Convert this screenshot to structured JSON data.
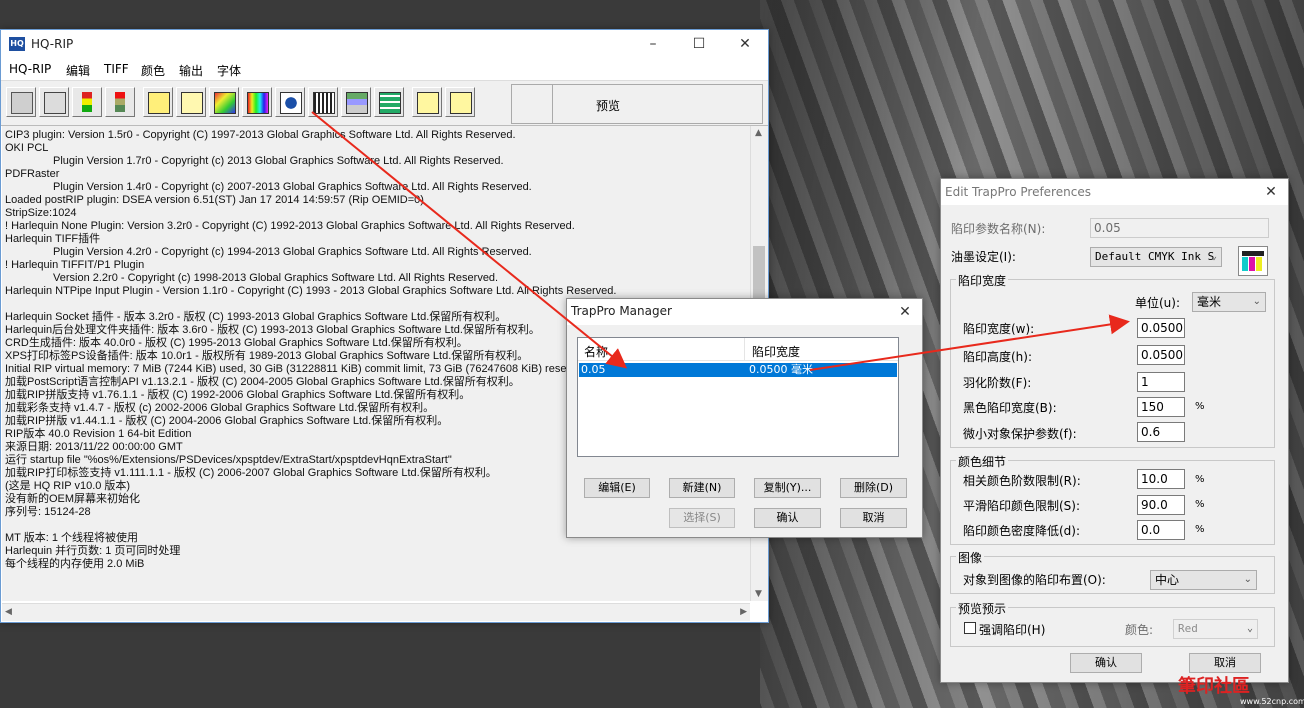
{
  "main": {
    "title": "HQ-RIP",
    "app_icon": "HQ",
    "menu": [
      "HQ-RIP",
      "编辑",
      "TIFF",
      "颜色",
      "输出",
      "字体"
    ],
    "toolbar_icons": [
      "printer-settings-icon",
      "print-queue-icon",
      "traffic-light-green-icon",
      "traffic-light-red-icon",
      "page-setup-icon",
      "document-list-icon",
      "color-palette-icon",
      "color-bars-icon",
      "calibration-icon",
      "film-icon",
      "stack-icon",
      "grid-layout-icon",
      "output-export-icon",
      "preview-image-icon"
    ],
    "preview_label": "预览",
    "log_lines": [
      {
        "t": "CIP3 plugin: Version 1.5r0 - Copyright (C) 1997-2013 Global Graphics Software Ltd. All Rights Reserved.",
        "i": false
      },
      {
        "t": "OKI PCL",
        "i": false
      },
      {
        "t": "Plugin Version 1.7r0 - Copyright (c) 2013 Global Graphics Software Ltd. All Rights Reserved.",
        "i": true
      },
      {
        "t": "PDFRaster",
        "i": false
      },
      {
        "t": "Plugin Version 1.4r0 - Copyright (c) 2007-2013 Global Graphics Software Ltd. All Rights Reserved.",
        "i": true
      },
      {
        "t": "Loaded postRIP plugin: DSEA version 6.51(ST) Jan 17 2014 14:59:57 (Rip OEMID=0)",
        "i": false
      },
      {
        "t": "StripSize:1024",
        "i": false
      },
      {
        "t": "! Harlequin None Plugin: Version 3.2r0 - Copyright (C) 1992-2013 Global Graphics Software Ltd. All Rights Reserved.",
        "i": false
      },
      {
        "t": "Harlequin TIFF插件",
        "i": false
      },
      {
        "t": "Plugin Version 4.2r0 - Copyright (c) 1994-2013 Global Graphics Software Ltd. All Rights Reserved.",
        "i": true
      },
      {
        "t": "! Harlequin TIFFIT/P1 Plugin",
        "i": false
      },
      {
        "t": "Version 2.2r0 - Copyright (c) 1998-2013 Global Graphics Software Ltd. All Rights Reserved.",
        "i": true
      },
      {
        "t": "Harlequin NTPipe Input Plugin - Version 1.1r0 - Copyright (C) 1993 - 2013 Global Graphics Software Ltd. All Rights Reserved.",
        "i": false
      },
      {
        "t": "",
        "i": false
      },
      {
        "t": "Harlequin Socket 插件 - 版本 3.2r0 - 版权 (C) 1993-2013 Global Graphics Software Ltd.保留所有权利。",
        "i": false
      },
      {
        "t": "Harlequin后台处理文件夹插件: 版本 3.6r0 - 版权 (C) 1993-2013 Global Graphics Software Ltd.保留所有权利。",
        "i": false
      },
      {
        "t": "CRD生成插件: 版本 40.0r0 - 版权 (C) 1995-2013 Global Graphics Software Ltd.保留所有权利。",
        "i": false
      },
      {
        "t": "XPS打印标签PS设备插件: 版本 10.0r1 - 版权所有 1989-2013 Global Graphics Software Ltd.保留所有权利。",
        "i": false
      },
      {
        "t": "Initial RIP virtual memory: 7 MiB (7244 KiB) used, 30 GiB (31228811 KiB) commit limit, 73 GiB (76247608 KiB) reserved",
        "i": false
      },
      {
        "t": "加载PostScript语言控制API v1.13.2.1 - 版权 (C) 2004-2005 Global Graphics Software Ltd.保留所有权利。",
        "i": false
      },
      {
        "t": "加载RIP拼版支持 v1.76.1.1 - 版权 (C) 1992-2006 Global Graphics Software Ltd.保留所有权利。",
        "i": false
      },
      {
        "t": "加载彩条支持 v1.4.7 - 版权 (c) 2002-2006 Global Graphics Software Ltd.保留所有权利。",
        "i": false
      },
      {
        "t": "加载RIP拼版 v1.44.1.1 - 版权 (C) 2004-2006 Global Graphics Software Ltd.保留所有权利。",
        "i": false
      },
      {
        "t": "RIP版本 40.0 Revision 1 64-bit Edition",
        "i": false
      },
      {
        "t": "来源日期: 2013/11/22 00:00:00 GMT",
        "i": false
      },
      {
        "t": "运行 startup file \"%os%/Extensions/PSDevices/xpsptdev/ExtraStart/xpsptdevHqnExtraStart\"",
        "i": false
      },
      {
        "t": "加载RIP打印标签支持 v1.111.1.1 - 版权 (C) 2006-2007 Global Graphics Software Ltd.保留所有权利。",
        "i": false
      },
      {
        "t": "(这是 HQ RIP v10.0 版本)",
        "i": false
      },
      {
        "t": "没有新的OEM屏幕来初始化",
        "i": false
      },
      {
        "t": "序列号: 15124-28",
        "i": false
      },
      {
        "t": "",
        "i": false
      },
      {
        "t": "MT 版本: 1 个线程将被使用",
        "i": false
      },
      {
        "t": "Harlequin 并行页数: 1 页可同时处理",
        "i": false
      },
      {
        "t": "每个线程的内存使用 2.0 MiB",
        "i": false
      }
    ]
  },
  "manager": {
    "title": "TrapPro Manager",
    "columns": [
      "名称",
      "陷印宽度"
    ],
    "rows": [
      {
        "name": "0.05",
        "width": "0.0500 毫米"
      }
    ],
    "buttons": {
      "edit": "编辑(E)",
      "new": "新建(N)",
      "copy": "复制(Y)...",
      "delete": "删除(D)",
      "select": "选择(S)",
      "ok": "确认",
      "cancel": "取消"
    }
  },
  "prefs": {
    "title": "Edit TrapPro Preferences",
    "param_name_label": "陷印参数名称(N):",
    "param_name_value": "0.05",
    "ink_label": "油墨设定(I):",
    "ink_value": "Default CMYK Ink S",
    "group_width": "陷印宽度",
    "unit_label": "单位(u):",
    "unit_value": "毫米",
    "trap_width_label": "陷印宽度(w):",
    "trap_width_value": "0.0500",
    "trap_height_label": "陷印高度(h):",
    "trap_height_value": "0.0500",
    "feather_label": "羽化阶数(F):",
    "feather_value": "1",
    "black_width_label": "黑色陷印宽度(B):",
    "black_width_value": "150",
    "small_obj_label": "微小对象保护参数(f):",
    "small_obj_value": "0.6",
    "group_color": "颜色细节",
    "step_limit_label": "相关颜色阶数限制(R):",
    "step_limit_value": "10.0",
    "smooth_label": "平滑陷印颜色限制(S):",
    "smooth_value": "90.0",
    "density_label": "陷印颜色密度降低(d):",
    "density_value": "0.0",
    "pct": "%",
    "group_image": "图像",
    "obj_image_label": "对象到图像的陷印布置(O):",
    "obj_image_value": "中心",
    "group_preview": "预览预示",
    "emphasize_label": "强调陷印(H)",
    "color_label": "颜色:",
    "color_value": "Red",
    "ok": "确认",
    "cancel": "取消"
  },
  "watermark": {
    "text": "筆印社區",
    "sub": "www.52cnp.com"
  },
  "colors": {
    "selection": "#0078d7",
    "arrow": "#e8291c"
  }
}
